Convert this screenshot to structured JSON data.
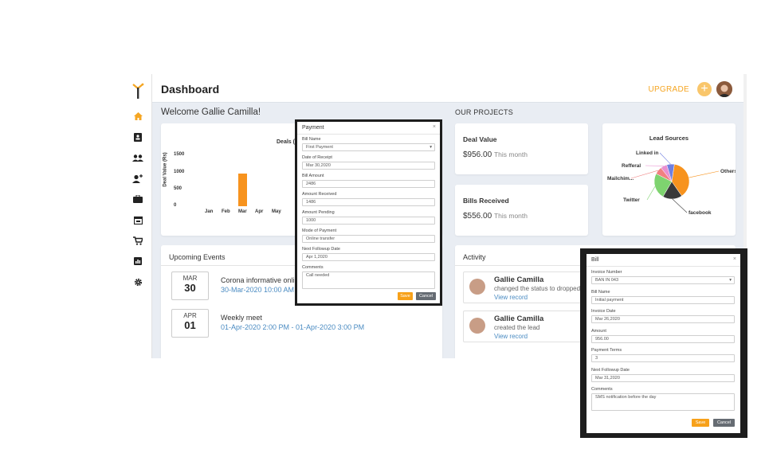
{
  "header": {
    "title": "Dashboard",
    "upgrade_label": "UPGRADE",
    "plus_label": "+"
  },
  "welcome": "Welcome Gallie Camilla!",
  "sidebar": {
    "items": [
      {
        "icon": "home-icon",
        "active": true
      },
      {
        "icon": "contact-book-icon"
      },
      {
        "icon": "users-icon"
      },
      {
        "icon": "add-user-icon"
      },
      {
        "icon": "briefcase-icon"
      },
      {
        "icon": "calendar-icon"
      },
      {
        "icon": "cart-icon"
      },
      {
        "icon": "report-chart-icon"
      },
      {
        "icon": "settings-icon"
      }
    ]
  },
  "deals_chart": {
    "title_partial": "Deals (",
    "chart_data": {
      "type": "bar",
      "title": "Deals (",
      "ylabel": "Deal Value (Rs)",
      "categories": [
        "Jan",
        "Feb",
        "Mar",
        "Apr",
        "May"
      ],
      "values": [
        0,
        0,
        956,
        0,
        0
      ],
      "yticks": [
        "1500",
        "1000",
        "500",
        "0"
      ],
      "ylim": [
        0,
        1600
      ],
      "bar_color": "#f7931e"
    }
  },
  "projects": {
    "title": "OUR PROJECTS",
    "deal_value": {
      "label": "Deal Value",
      "amount": "$956.00",
      "period": "This month"
    },
    "bills_received": {
      "label": "Bills Received",
      "amount": "$556.00",
      "period": "This month"
    }
  },
  "lead_sources": {
    "title": "Lead Sources",
    "chart_data": {
      "type": "pie",
      "title": "Lead Sources",
      "labels": [
        "Others",
        "facebook",
        "Twitter",
        "Mailchim...",
        "Refferal",
        "Linked in"
      ],
      "values": [
        38,
        18,
        24,
        7,
        6,
        7
      ],
      "colors": [
        "#f7931e",
        "#3a3a3a",
        "#7ed36f",
        "#f08080",
        "#e98fd0",
        "#6f7fe0"
      ]
    }
  },
  "events": {
    "title": "Upcoming Events",
    "items": [
      {
        "month": "MAR",
        "day": "30",
        "title": "Corona informative online",
        "time": "30-Mar-2020 10:00 AM - 3"
      },
      {
        "month": "APR",
        "day": "01",
        "title": "Weekly meet",
        "time": "01-Apr-2020 2:00 PM - 01-Apr-2020 3:00 PM"
      }
    ]
  },
  "activity": {
    "title": "Activity",
    "items": [
      {
        "name": "Gallie Camilla",
        "desc": "changed the status to dropped",
        "link": "View record"
      },
      {
        "name": "Gallie Camilla",
        "desc": "created the lead",
        "link": "View record"
      }
    ]
  },
  "payment_modal": {
    "title": "Payment",
    "close": "×",
    "fields": [
      {
        "label": "Bill Name",
        "value": "First Payment",
        "select": true
      },
      {
        "label": "Date of Receipt",
        "value": "Mar 30,2020"
      },
      {
        "label": "Bill Amount",
        "value": "2486"
      },
      {
        "label": "Amount Received",
        "value": "1486"
      },
      {
        "label": "Amount Pending",
        "value": "1000"
      },
      {
        "label": "Mode of Payment",
        "value": "Online transfer"
      },
      {
        "label": "Next Followup Date",
        "value": "Apr 1,2020"
      },
      {
        "label": "Comments",
        "value": "Call needed"
      }
    ],
    "save_label": "Save",
    "cancel_label": "Cancel"
  },
  "bill_modal": {
    "title": "Bill",
    "close": "×",
    "fields": [
      {
        "label": "Invoice Number",
        "value": "BAN IN 043",
        "select": true
      },
      {
        "label": "Bill Name",
        "value": "Initial payment"
      },
      {
        "label": "Invoice Date",
        "value": "Mar 26,2020"
      },
      {
        "label": "Amount",
        "value": "956.00"
      },
      {
        "label": "Payment Terms",
        "value": "3"
      },
      {
        "label": "Next Followup Date",
        "value": "Mar 31,2020"
      },
      {
        "label": "Comments",
        "value": "SMS notification before the day"
      }
    ],
    "save_label": "Save",
    "cancel_label": "Cancel"
  },
  "colors": {
    "accent": "#f7931e",
    "link": "#4a8bc2",
    "cancel": "#666c73"
  }
}
